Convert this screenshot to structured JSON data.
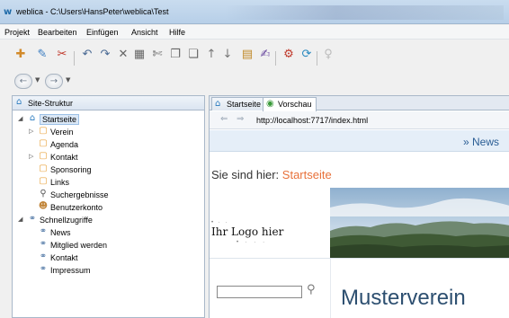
{
  "window": {
    "title": "weblica - C:\\Users\\HansPeter\\weblica\\Test"
  },
  "menu": [
    {
      "label": "Projekt"
    },
    {
      "label": "Bearbeiten"
    },
    {
      "label": "Einfügen"
    },
    {
      "label": "Ansicht"
    },
    {
      "label": "Hilfe"
    }
  ],
  "toolbar": {
    "icons": [
      "new-page-icon",
      "new-folder-icon",
      "delete-icon",
      "undo-icon",
      "redo-icon",
      "remove-icon",
      "table-icon",
      "cut-icon",
      "copy-icon",
      "paste-icon",
      "move-up-icon",
      "move-down-icon",
      "properties-icon",
      "spellcheck-icon",
      "settings-icon",
      "publish-icon",
      "tip-icon"
    ]
  },
  "navigation": {
    "back_icon": "back-arrow-icon",
    "forward_icon": "forward-arrow-icon"
  },
  "site_structure": {
    "tab_label": "Site-Struktur",
    "items": [
      {
        "label": "Startseite"
      },
      {
        "label": "Verein"
      },
      {
        "label": "Agenda"
      },
      {
        "label": "Kontakt"
      },
      {
        "label": "Sponsoring"
      },
      {
        "label": "Links"
      },
      {
        "label": "Suchergebnisse"
      },
      {
        "label": "Benutzerkonto"
      },
      {
        "label": "Schnellzugriffe"
      },
      {
        "label": "News"
      },
      {
        "label": "Mitglied werden"
      },
      {
        "label": "Kontakt"
      },
      {
        "label": "Impressum"
      }
    ]
  },
  "editor": {
    "tabs": [
      {
        "label": "Startseite"
      },
      {
        "label": "Vorschau"
      }
    ],
    "address": "http://localhost:7717/index.html"
  },
  "preview": {
    "news_link": "» News",
    "breadcrumb_prefix": "Sie sind hier:",
    "breadcrumb_current": "Startseite",
    "logo_text": "Ihr Logo hier",
    "site_title": "Musterverein"
  },
  "colors": {
    "accent": "#2a7bbf",
    "breadcrumb_current": "#e8713a",
    "site_title": "#2d4f70"
  }
}
